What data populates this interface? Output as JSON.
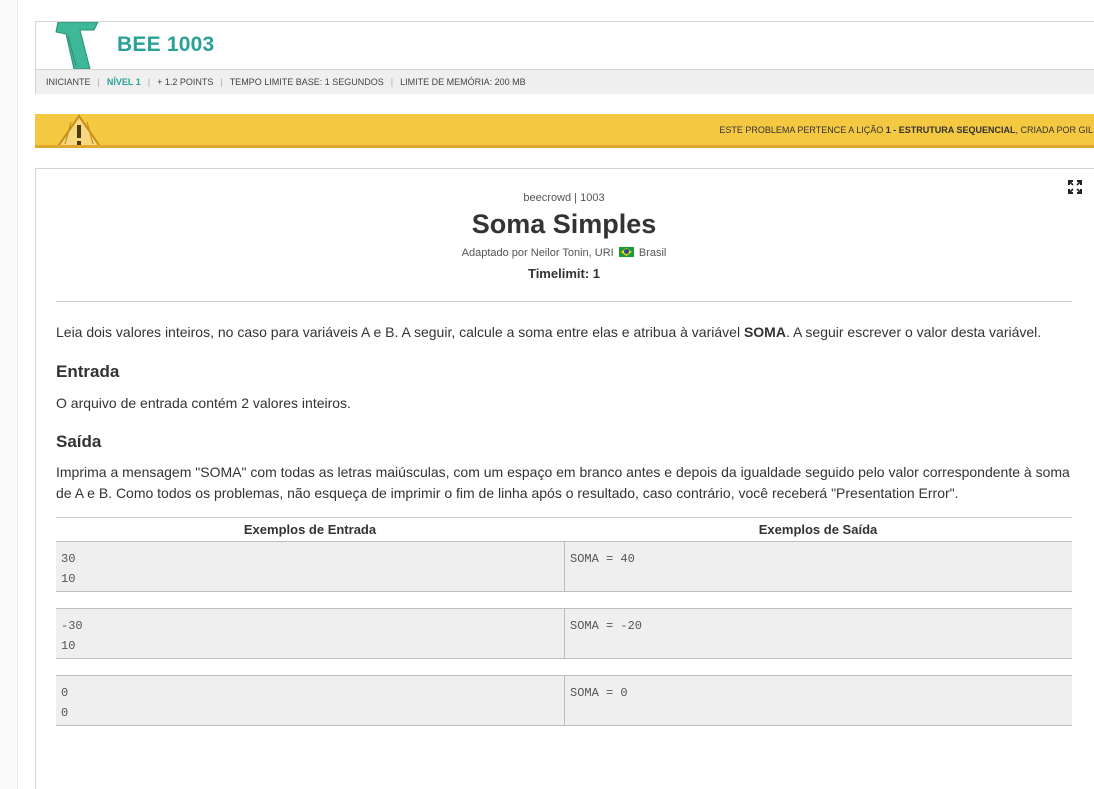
{
  "header": {
    "problem_id": "BEE 1003",
    "meta": {
      "category": "INICIANTE",
      "level": "NÍVEL 1",
      "points": "+ 1.2 POINTS",
      "time_limit": "TEMPO LIMITE BASE: 1 SEGUNDOS",
      "memory_limit": "LIMITE DE MEMÓRIA: 200 MB"
    }
  },
  "banner": {
    "prefix": "ESTE PROBLEMA PERTENCE A LIÇÃO ",
    "lesson": "1 - ESTRUTURA SEQUENCIAL",
    "suffix": ", CRIADA POR GIL"
  },
  "problem": {
    "source": "beecrowd | 1003",
    "title": "Soma Simples",
    "author_prefix": "Adaptado por Neilor Tonin, URI",
    "country": "Brasil",
    "timelimit": "Timelimit: 1",
    "description_start": "Leia dois valores inteiros, no caso para variáveis A e B. A seguir, calcule a soma entre elas e atribua à variável ",
    "description_bold": "SOMA",
    "description_end": ". A seguir escrever o valor desta variável.",
    "input_heading": "Entrada",
    "input_text": "O arquivo de entrada contém 2 valores inteiros.",
    "output_heading": "Saída",
    "output_text": "Imprima a mensagem \"SOMA\" com todas as letras maiúsculas, com um espaço em branco antes e depois da igualdade seguido pelo valor correspondente à soma de A e B. Como todos os problemas, não esqueça de imprimir o fim de linha após o resultado, caso contrário, você receberá \"Presentation Error\"."
  },
  "examples": {
    "input_header": "Exemplos de Entrada",
    "output_header": "Exemplos de Saída",
    "rows": [
      {
        "input": "30\n10",
        "output": "SOMA = 40"
      },
      {
        "input": "-30\n10",
        "output": "SOMA = -20"
      },
      {
        "input": "0\n0",
        "output": "SOMA = 0"
      }
    ]
  },
  "colors": {
    "accent": "#2aa198",
    "banner": "#f5c842",
    "example_bg": "#efefef"
  }
}
